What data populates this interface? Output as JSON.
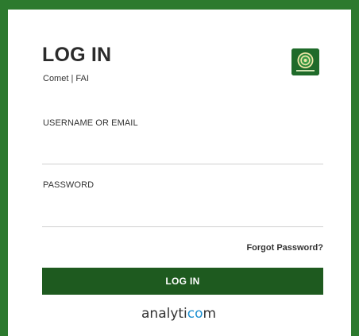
{
  "login": {
    "title": "LOG IN",
    "subtitle": "Comet | FAI",
    "username_label": "USERNAME OR EMAIL",
    "username_value": "",
    "password_label": "PASSWORD",
    "password_value": "",
    "forgot_label": "Forgot Password?",
    "submit_label": "LOG IN"
  },
  "logo": {
    "icon": "organization-seal-icon"
  },
  "footer": {
    "brand_prefix": "analyti",
    "brand_mid": "co",
    "brand_suffix": "m"
  },
  "colors": {
    "frame_green": "#2c7a2e",
    "button_green": "#1e5a1f",
    "brand_accent": "#1a8fd1"
  }
}
